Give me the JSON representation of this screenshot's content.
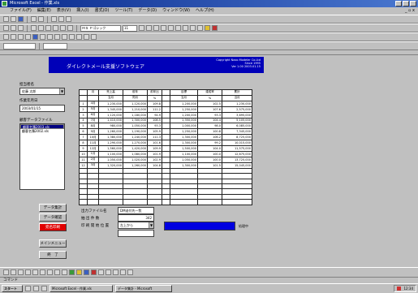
{
  "window": {
    "title": "Microsoft Excel - 作業.xls"
  },
  "menu": {
    "items": [
      "ファイル(F)",
      "編集(E)",
      "表示(V)",
      "挿入(I)",
      "書式(O)",
      "ツール(T)",
      "データ(D)",
      "ウィンドウ(W)",
      "ヘルプ(H)"
    ],
    "close": "_ ▫ x"
  },
  "toolbar2": {
    "font_select": "ＭＳ Ｐゴシック",
    "size_select": "11"
  },
  "banner": {
    "title": "ダイレクトメール支援ソフトウェア",
    "company_line1": "Copyright Naxo Modeler Co.Ltd",
    "company_line2": "Since 1995",
    "company_line3": "Ver 1.00 2003.01.15"
  },
  "left_panel": {
    "label1": "担当者名",
    "select1": "佐藤 太郎",
    "label2": "作業年月日",
    "date_value": "2003/01/15",
    "label3": "顧客データファイル",
    "list_items": [
      "顧客名簿2003.xls",
      "顧客名簿2002.xls"
    ]
  },
  "table": {
    "header1": [
      "",
      "月",
      "売上高",
      "前年",
      "前年比",
      "",
      "目標",
      "達成率",
      "累計"
    ],
    "header2": [
      "",
      "",
      "当月",
      "同月",
      "%",
      "",
      "当月",
      "%",
      "当月"
    ],
    "rows": [
      [
        "1",
        "4月",
        "1,230,000",
        "1,120,000",
        "109.8",
        "",
        "1,200,000",
        "102.5",
        "1,230,000"
      ],
      [
        "2",
        "5月",
        "1,345,000",
        "1,210,000",
        "111.2",
        "",
        "1,250,000",
        "107.6",
        "2,575,000"
      ],
      [
        "3",
        "6月",
        "1,120,000",
        "1,180,000",
        "94.9",
        "",
        "1,200,000",
        "93.3",
        "3,695,000"
      ],
      [
        "4",
        "7月",
        "1,410,000",
        "1,300,000",
        "108.5",
        "",
        "1,350,000",
        "104.4",
        "5,105,000"
      ],
      [
        "5",
        "8月",
        "980,000",
        "1,050,000",
        "93.3",
        "",
        "1,000,000",
        "98.0",
        "6,085,000"
      ],
      [
        "6",
        "9月",
        "1,260,000",
        "1,190,000",
        "105.9",
        "",
        "1,250,000",
        "100.8",
        "7,345,000"
      ],
      [
        "7",
        "10月",
        "1,380,000",
        "1,240,000",
        "111.3",
        "",
        "1,300,000",
        "106.2",
        "8,725,000"
      ],
      [
        "8",
        "11月",
        "1,290,000",
        "1,270,000",
        "101.6",
        "",
        "1,300,000",
        "99.2",
        "10,015,000"
      ],
      [
        "9",
        "12月",
        "1,560,000",
        "1,420,000",
        "109.9",
        "",
        "1,500,000",
        "104.0",
        "11,575,000"
      ],
      [
        "10",
        "1月",
        "1,100,000",
        "1,080,000",
        "101.9",
        "",
        "1,100,000",
        "100.0",
        "12,675,000"
      ],
      [
        "11",
        "2月",
        "1,050,000",
        "1,020,000",
        "102.9",
        "",
        "1,050,000",
        "100.0",
        "13,725,000"
      ],
      [
        "12",
        "3月",
        "1,320,000",
        "1,260,000",
        "104.8",
        "",
        "1,300,000",
        "101.5",
        "15,045,000"
      ]
    ],
    "blank_rows": 7
  },
  "buttons": {
    "b1": "データ集計",
    "b2": "データ確認",
    "b3": "宛名印刷",
    "b4": "メインメニュー",
    "b5": "終　了"
  },
  "form": {
    "label1": "出力ファイル名",
    "value1": "DM送付先一覧",
    "label2": "抽 出 件 数",
    "value2": "342",
    "label3": "印 刷 開 始 位 置",
    "value3": "左上から",
    "progress_label": "処理中"
  },
  "status": {
    "text": "コマンド"
  },
  "taskbar": {
    "start": "スタート",
    "tasks": [
      "Microsoft Excel - 作業.xls",
      "データ集計 - Microsoft"
    ],
    "clock": "12:34"
  }
}
